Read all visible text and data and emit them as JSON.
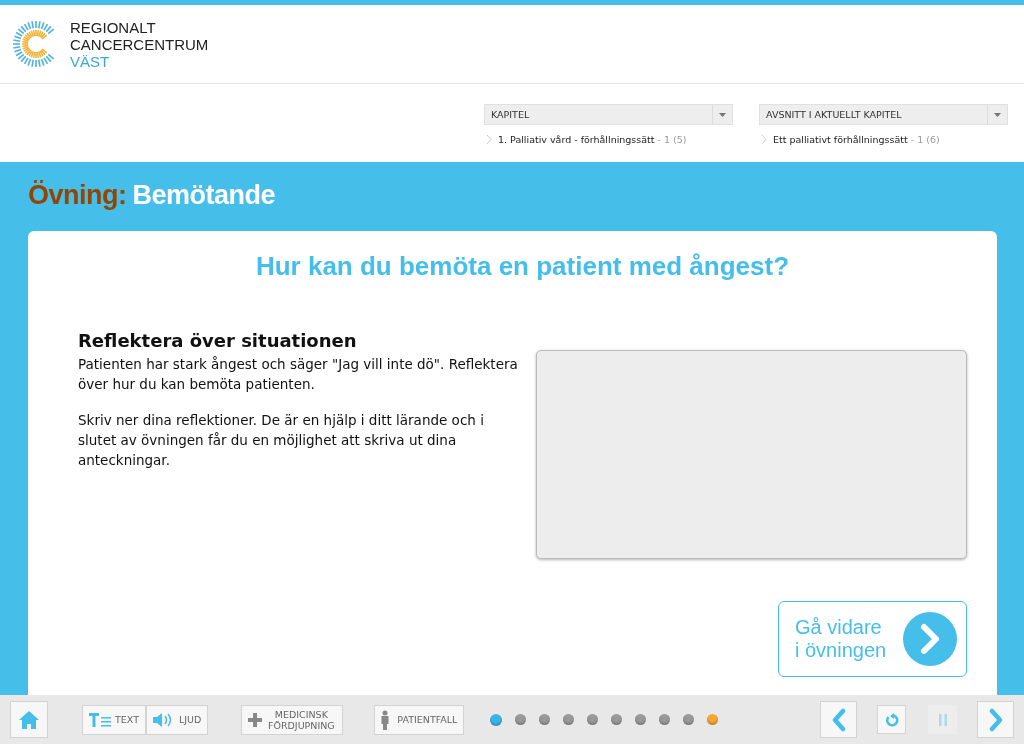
{
  "logo": {
    "lines": [
      "REGIONALT",
      "CANCERCENTRUM"
    ],
    "region": "VÄST"
  },
  "nav": [
    {
      "label": "KAPITEL",
      "current": "1. Palliativ vård - förhållningssätt",
      "count": "- 1 (5)"
    },
    {
      "label": "AVSNITT I AKTUELLT KAPITEL",
      "current": "Ett palliativt förhållningssätt",
      "count": "- 1 (6)"
    }
  ],
  "exercise": {
    "prefix": "Övning:",
    "title": "Bemötande"
  },
  "card": {
    "question": "Hur kan du bemöta en patient med ångest?",
    "heading": "Reflektera över situationen",
    "paragraphs": [
      "Patienten har stark ångest och säger \"Jag vill inte dö\". Reflektera över hur du kan bemöta patienten.",
      "Skriv ner dina reflektioner. De är en hjälp i ditt lärande och i slutet av övningen får du en möjlighet att skriva ut dina anteckningar."
    ],
    "next_button": "Gå vidare i övningen"
  },
  "toolbar": {
    "text_button": "TEXT",
    "audio_button": "LJUD",
    "medical_button": "MEDICINSK FÖRDJUPNING",
    "patient_button": "PATIENTFALL",
    "dots": [
      {
        "selected": true,
        "color": "#3bb4e6"
      },
      {
        "selected": false,
        "color": "#999999"
      },
      {
        "selected": false,
        "color": "#999999"
      },
      {
        "selected": false,
        "color": "#999999"
      },
      {
        "selected": false,
        "color": "#999999"
      },
      {
        "selected": false,
        "color": "#999999"
      },
      {
        "selected": false,
        "color": "#999999"
      },
      {
        "selected": false,
        "color": "#999999"
      },
      {
        "selected": false,
        "color": "#999999"
      },
      {
        "selected": false,
        "color": "#f5a733"
      }
    ],
    "pause_disabled": true
  }
}
